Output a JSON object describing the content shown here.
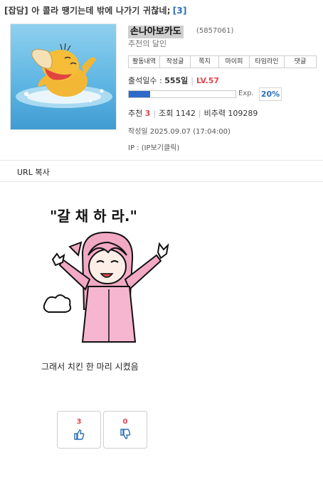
{
  "post": {
    "title": "[잡담] 아 콜라 땡기는데 밖에 나가기 귀찮네;",
    "comment_count": "[3]"
  },
  "author": {
    "nickname": "손나아보카도",
    "uid": "(5857061)",
    "rank": "추천의 달인",
    "menu": [
      "활동내역",
      "작성글",
      "쪽지",
      "마이피",
      "타임라인",
      "댓글"
    ],
    "attendance_label": "출석일수 :",
    "attendance_value": "555일",
    "level": "LV.57",
    "exp_label": "Exp.",
    "exp_percent": "20%",
    "exp_fraction": 0.2
  },
  "stats": {
    "recommend_label": "추천",
    "recommend_value": "3",
    "views": "조회 1142",
    "nonrecommend": "비추력 109289",
    "date": "작성일 2025.09.07 (17:04:00)",
    "ip": "IP : (IP보기클릭)"
  },
  "actions": {
    "url_copy": "URL 복사"
  },
  "content": {
    "image_text": "\"갈 채 하 라.\"",
    "caption": "그래서 치킨 한 마리 시켰음"
  },
  "votes": {
    "up": "3",
    "down": "0"
  },
  "colors": {
    "accent_blue": "#2a6eb5",
    "accent_red": "#e0464d",
    "exp_fill": "#2e6ac9"
  }
}
